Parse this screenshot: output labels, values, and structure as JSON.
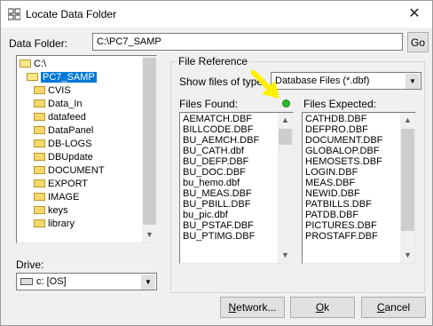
{
  "window": {
    "title": "Locate Data Folder",
    "close_glyph": "✕"
  },
  "data_folder": {
    "label": "Data Folder:",
    "value": "C:\\PC7_SAMP",
    "go_label": "Go"
  },
  "tree": {
    "items": [
      {
        "label": "C:\\",
        "type": "open",
        "indent": 0
      },
      {
        "label": "PC7_SAMP",
        "type": "open",
        "indent": 1,
        "selected": true
      },
      {
        "label": "CVIS",
        "type": "folder",
        "indent": 2
      },
      {
        "label": "Data_In",
        "type": "folder",
        "indent": 2
      },
      {
        "label": "datafeed",
        "type": "folder",
        "indent": 2
      },
      {
        "label": "DataPanel",
        "type": "folder",
        "indent": 2
      },
      {
        "label": "DB-LOGS",
        "type": "folder",
        "indent": 2
      },
      {
        "label": "DBUpdate",
        "type": "folder",
        "indent": 2
      },
      {
        "label": "DOCUMENT",
        "type": "folder",
        "indent": 2
      },
      {
        "label": "EXPORT",
        "type": "folder",
        "indent": 2
      },
      {
        "label": "IMAGE",
        "type": "folder",
        "indent": 2
      },
      {
        "label": "keys",
        "type": "folder",
        "indent": 2
      },
      {
        "label": "library",
        "type": "folder",
        "indent": 2
      }
    ]
  },
  "drive": {
    "label": "Drive:",
    "value": "c: [OS]"
  },
  "file_reference": {
    "legend": "File Reference",
    "show_label": "Show files of type:",
    "type_value": "Database Files (*.dbf)",
    "found_label": "Files Found:",
    "expected_label": "Files Expected:",
    "status_color": "#22c322",
    "found": [
      "AEMATCH.DBF",
      "BILLCODE.DBF",
      "BU_AEMCH.DBF",
      "BU_CATH.dbf",
      "BU_DEFP.DBF",
      "BU_DOC.DBF",
      "bu_hemo.dbf",
      "BU_MEAS.DBF",
      "BU_PBILL.DBF",
      "bu_pic.dbf",
      "BU_PSTAF.DBF",
      "BU_PTIMG.DBF"
    ],
    "expected": [
      "CATHDB.DBF",
      "DEFPRO.DBF",
      "DOCUMENT.DBF",
      "GLOBALOP.DBF",
      "HEMOSETS.DBF",
      "LOGIN.DBF",
      "MEAS.DBF",
      "NEWID.DBF",
      "PATBILLS.DBF",
      "PATDB.DBF",
      "PICTURES.DBF",
      "PROSTAFF.DBF"
    ]
  },
  "buttons": {
    "network": "Network...",
    "ok": "Ok",
    "cancel": "Cancel"
  },
  "colors": {
    "highlight": "#0078d7",
    "arrow": "#ffef00"
  }
}
